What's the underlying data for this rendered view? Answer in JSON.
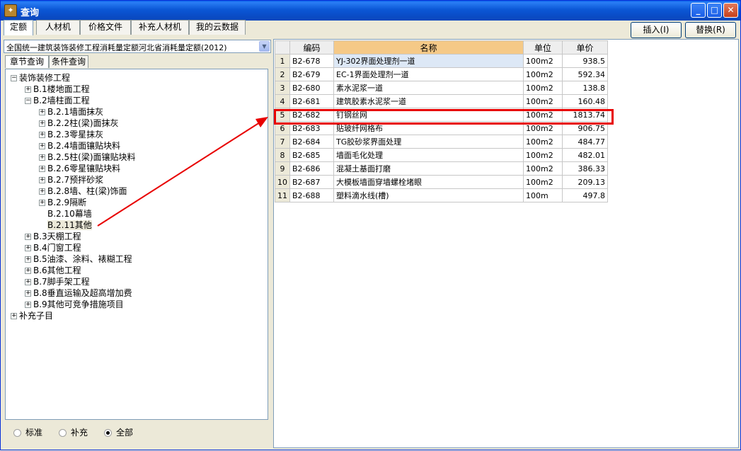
{
  "window": {
    "title": "查询"
  },
  "tabs": [
    "定额",
    "人材机",
    "价格文件",
    "补充人材机",
    "我的云数据"
  ],
  "buttons": {
    "insert": "插入(I)",
    "replace": "替换(R)"
  },
  "combo": {
    "value": "全国统一建筑装饰装修工程消耗量定额河北省消耗量定额(2012)"
  },
  "subtabs": [
    "章节查询",
    "条件查询"
  ],
  "tree": [
    {
      "label": "装饰装修工程",
      "sign": "⊟"
    },
    {
      "label": "B.1楼地面工程",
      "sign": "⊞"
    },
    {
      "label": "B.2墙柱面工程",
      "sign": "⊟"
    },
    {
      "label": "B.2.1墙面抹灰",
      "sign": "⊞"
    },
    {
      "label": "B.2.2柱(梁)面抹灰",
      "sign": "⊞"
    },
    {
      "label": "B.2.3零星抹灰",
      "sign": "⊞"
    },
    {
      "label": "B.2.4墙面镶贴块料",
      "sign": "⊞"
    },
    {
      "label": "B.2.5柱(梁)面镶贴块料",
      "sign": "⊞"
    },
    {
      "label": "B.2.6零星镶贴块料",
      "sign": "⊞"
    },
    {
      "label": "B.2.7预拌砂浆",
      "sign": "⊞"
    },
    {
      "label": "B.2.8墙、柱(梁)饰面",
      "sign": "⊞"
    },
    {
      "label": "B.2.9隔断",
      "sign": "⊞"
    },
    {
      "label": "B.2.10幕墙",
      "sign": ""
    },
    {
      "label": "B.2.11其他",
      "sign": ""
    },
    {
      "label": "B.3天棚工程",
      "sign": "⊞"
    },
    {
      "label": "B.4门窗工程",
      "sign": "⊞"
    },
    {
      "label": "B.5油漆、涂料、裱糊工程",
      "sign": "⊞"
    },
    {
      "label": "B.6其他工程",
      "sign": "⊞"
    },
    {
      "label": "B.7脚手架工程",
      "sign": "⊞"
    },
    {
      "label": "B.8垂直运输及超高增加费",
      "sign": "⊞"
    },
    {
      "label": "B.9其他可竞争措施项目",
      "sign": "⊞"
    },
    {
      "label": "补充子目",
      "sign": "⊞"
    }
  ],
  "radios": [
    {
      "label": "标准",
      "checked": false
    },
    {
      "label": "补充",
      "checked": false
    },
    {
      "label": "全部",
      "checked": true
    }
  ],
  "table": {
    "headers": [
      "",
      "编码",
      "名称",
      "单位",
      "单价"
    ],
    "rows": [
      [
        "1",
        "B2-678",
        "YJ-302界面处理剂一道",
        "100m2",
        "938.5"
      ],
      [
        "2",
        "B2-679",
        "EC-1界面处理剂一道",
        "100m2",
        "592.34"
      ],
      [
        "3",
        "B2-680",
        "素水泥浆一道",
        "100m2",
        "138.8"
      ],
      [
        "4",
        "B2-681",
        "建筑胶素水泥浆一道",
        "100m2",
        "160.48"
      ],
      [
        "5",
        "B2-682",
        "钉钢丝网",
        "100m2",
        "1813.74"
      ],
      [
        "6",
        "B2-683",
        "贴玻纤网格布",
        "100m2",
        "906.75"
      ],
      [
        "7",
        "B2-684",
        "TG胶砂浆界面处理",
        "100m2",
        "484.77"
      ],
      [
        "8",
        "B2-685",
        "墙面毛化处理",
        "100m2",
        "482.01"
      ],
      [
        "9",
        "B2-686",
        "混凝土基面打磨",
        "100m2",
        "386.33"
      ],
      [
        "10",
        "B2-687",
        "大模板墙面穿墙螺栓堵眼",
        "100m2",
        "209.13"
      ],
      [
        "11",
        "B2-688",
        "塑料滴水线(槽)",
        "100m",
        "497.8"
      ]
    ]
  },
  "colors": {
    "highlight": "#e80000",
    "titlebar": "#0a4bc4",
    "header_name": "#f5c987"
  }
}
